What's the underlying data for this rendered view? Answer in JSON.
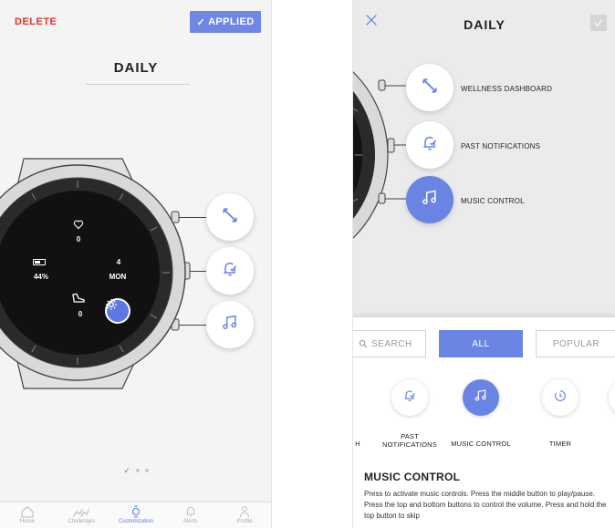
{
  "left_screen": {
    "delete_label": "DELETE",
    "applied_label": "APPLIED",
    "face_name": "DAILY",
    "watch_face": {
      "heart_value": "0",
      "battery_value": "44%",
      "date_number": "4",
      "date_day": "MON",
      "steps_value": "0"
    },
    "bottom_nav": [
      {
        "label": "Home",
        "icon": "home-icon"
      },
      {
        "label": "Challenges",
        "icon": "runners-icon"
      },
      {
        "label": "Customization",
        "icon": "watch-icon"
      },
      {
        "label": "Alerts",
        "icon": "bell-icon"
      },
      {
        "label": "Profile",
        "icon": "person-icon"
      }
    ]
  },
  "right_screen": {
    "title": "DAILY",
    "actions": [
      {
        "label": "WELLNESS DASHBOARD",
        "icon": "expand-arrows-icon"
      },
      {
        "label": "PAST NOTIFICATIONS",
        "icon": "bell-check-icon"
      },
      {
        "label": "MUSIC CONTROL",
        "icon": "music-note-icon"
      }
    ],
    "search_placeholder": "SEARCH",
    "tabs": {
      "all": "ALL",
      "popular": "POPULAR"
    },
    "carousel": [
      {
        "label": "H",
        "icon": "partial-icon"
      },
      {
        "label": "PAST NOTIFICATIONS",
        "icon": "bell-check-icon"
      },
      {
        "label": "MUSIC CONTROL",
        "icon": "music-note-icon"
      },
      {
        "label": "TIMER",
        "icon": "timer-icon"
      }
    ],
    "description_title": "MUSIC CONTROL",
    "description_body": "Press to activate music controls. Press the middle button to play/pause. Press the top and bottom buttons to control the volume. Press and hold the top button to skip"
  },
  "colors": {
    "accent": "#6a84e4",
    "delete_red": "#e5322d",
    "watch_bezel": "#d9d9d9",
    "watch_dial": "#111111"
  }
}
